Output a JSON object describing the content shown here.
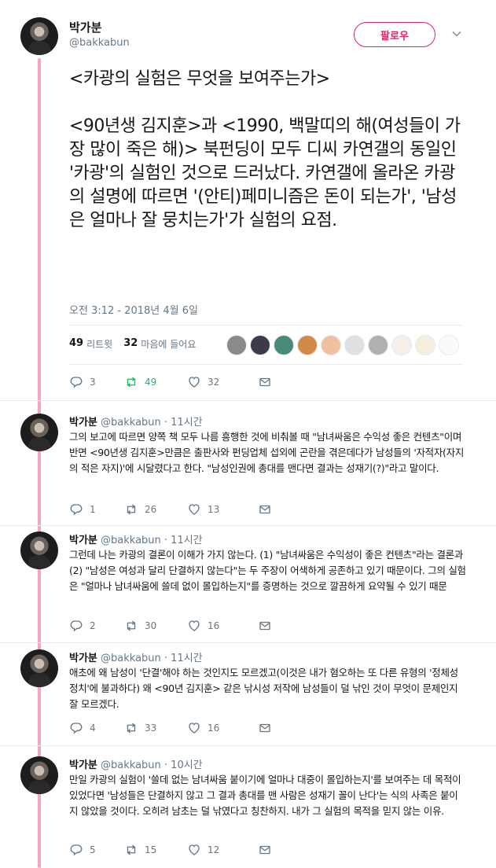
{
  "colors": {
    "accent": "#e0245e",
    "thread_line": "#f4a7bd",
    "retweet_green": "#17bf63",
    "muted": "#657786"
  },
  "main_tweet": {
    "author_name": "박가분",
    "author_handle": "@bakkabun",
    "follow_label": "팔로우",
    "text": "<카광의 실험은 무엇을 보여주는가>\n\n<90년생 김지훈>과 <1990, 백말띠의 해(여성들이 가장 많이 죽은 해)> 북펀딩이 모두 디씨 카연갤의 동일인 '카광'의 실험인 것으로 드러났다. 카연갤에 올라온 카광의 설명에 따르면 '(안티)페미니즘은 돈이 되는가', '남성은 얼마나 잘 뭉치는가'가 실험의 요점.",
    "timestamp": "오전 3:12 - 2018년 4월 6일",
    "retweet_count": "49",
    "retweet_label": "리트윗",
    "like_count": "32",
    "like_label": "마음에 들어요",
    "actions": {
      "reply": "3",
      "retweet": "49",
      "like": "32"
    }
  },
  "replies": [
    {
      "name": "박가분",
      "handle_time": "@bakkabun · 11시간",
      "text": "그의 보고에 따르면 양쪽 책 모두 나름 흥행한 것에 비춰볼 때 \"남녀싸움은 수익성 좋은 컨텐츠\"이며 반면 <90년생 김지훈>만큼은 출판사와 펀딩업체 섭외에 곤란을 겪은데다가 남성들의 '자적자(자지의 적은 자지)'에 시달렸다고 한다. \"남성인권에 총대를 맨다면 결과는 성재기(?)\"라고 말이다.",
      "actions": {
        "reply": "1",
        "retweet": "26",
        "like": "13"
      }
    },
    {
      "name": "박가분",
      "handle_time": "@bakkabun · 11시간",
      "text": "그런데 나는 카광의 결론이 이해가 가지 않는다. (1) \"남녀싸움은 수익성이 좋은 컨텐츠\"라는 결론과 (2) \"남성은 여성과 달리 단결하지 않는다\"는 두 주장이 어색하게 공존하고 있기 때문이다. 그의 실험은 \"얼마나 남녀싸움에 쓸데 없이 몰입하는지\"를 증명하는 것으로 깔끔하게 요약될 수 있기 때문",
      "actions": {
        "reply": "2",
        "retweet": "30",
        "like": "16"
      }
    },
    {
      "name": "박가분",
      "handle_time": "@bakkabun · 11시간",
      "text": "애초에 왜 남성이 '단결'해야 하는 것인지도 모르겠고(이것은 내가 혐오하는 또 다른 유형의 '정체성 정치'에 불과하다) 왜 <90년 김지훈> 같은 낚시성 저작에 남성들이 덜 낚인 것이 무엇이 문제인지 잘 모르겠다.",
      "actions": {
        "reply": "4",
        "retweet": "33",
        "like": "16"
      }
    },
    {
      "name": "박가분",
      "handle_time": "@bakkabun · 10시간",
      "text": "만일 카광의 실험이 '쓸데 없는 남녀싸움 붙이기에 얼마나 대중이 몰입하는지'를 보여주는 데 목적이 있었다면 '남성들은 단결하지 않고 그 결과 총대를 맨 사람은 성재기 꼴이 난다'는 식의 사족은 붙이지 않았을 것이다. 오히려 남초는 덜 낚였다고 칭찬하지. 내가 그 실험의 목적을 믿지 않는 이유.",
      "actions": {
        "reply": "5",
        "retweet": "15",
        "like": "12"
      }
    }
  ],
  "icons": {
    "reply": "reply-icon",
    "retweet": "retweet-icon",
    "like": "heart-icon",
    "dm": "envelope-icon",
    "more": "chevron-down-icon"
  },
  "liker_colors": [
    "#8a8a8a",
    "#3b3b4a",
    "#4a8a7a",
    "#d08a4a",
    "#f0c0a0",
    "#e0e0e0",
    "#b0b0b0",
    "#f4f0e8",
    "#f6eedd",
    "#fafafa"
  ]
}
